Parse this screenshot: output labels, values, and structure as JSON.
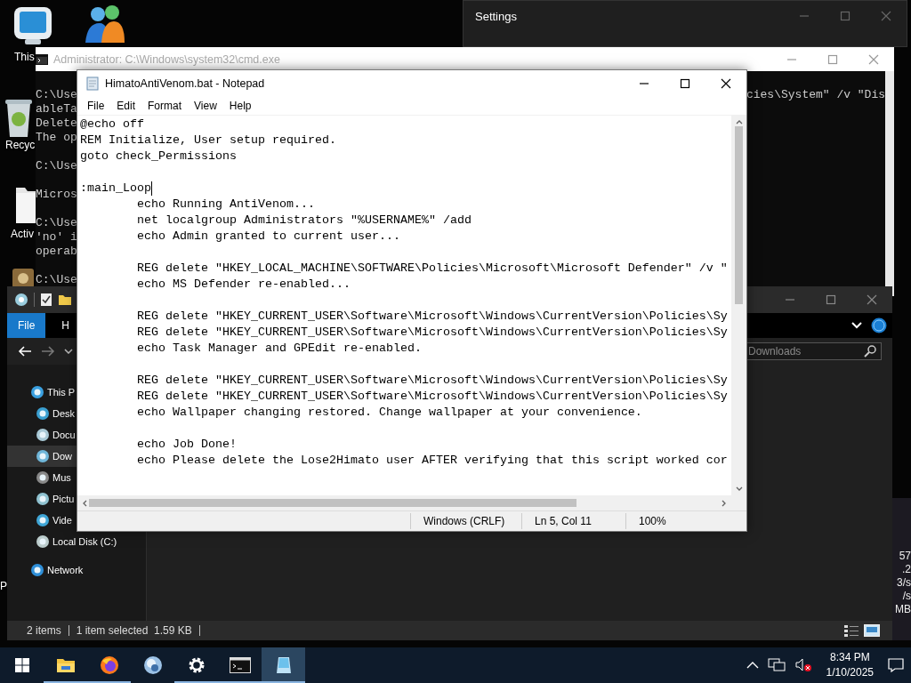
{
  "desktop": {
    "icons": [
      {
        "kind": "monitor",
        "label": "This"
      },
      {
        "kind": "people"
      },
      {
        "kind": "recycle",
        "label": "Recyc"
      },
      {
        "kind": "folder",
        "label": "Activ"
      },
      {
        "kind": "app"
      },
      {
        "kind": "blank",
        "label": "P"
      }
    ]
  },
  "settings_window": {
    "title": "Settings"
  },
  "cmd_window": {
    "title": "Administrator: C:\\Windows\\system32\\cmd.exe",
    "lines": [
      {
        "kind": "text",
        "left": "C:\\Use",
        "right": "cies\\System\" /v \"Dis"
      },
      {
        "kind": "text",
        "left": "ableTa"
      },
      {
        "kind": "text",
        "left": "Delete"
      },
      {
        "kind": "text",
        "left": "The op"
      },
      {
        "kind": "blank"
      },
      {
        "kind": "text",
        "left": "C:\\Use"
      },
      {
        "kind": "blank"
      },
      {
        "kind": "text",
        "left": "Micros"
      },
      {
        "kind": "blank"
      },
      {
        "kind": "text",
        "left": "C:\\Use"
      },
      {
        "kind": "text",
        "left": "'no' i"
      },
      {
        "kind": "text",
        "left": "operab"
      },
      {
        "kind": "blank"
      },
      {
        "kind": "text",
        "left": "C:\\Use"
      }
    ]
  },
  "explorer": {
    "ribbon_tabs": [
      {
        "label": "File",
        "selected": true
      },
      {
        "label": "H",
        "selected": false
      }
    ],
    "search": {
      "placeholder": "Downloads"
    },
    "nav": [
      {
        "label": "This P",
        "kind": "pc",
        "selected": false,
        "children": [
          {
            "label": "Desk",
            "kind": "desktop",
            "selected": false
          },
          {
            "label": "Docu",
            "kind": "documents",
            "selected": false
          },
          {
            "label": "Dow",
            "kind": "downloads",
            "selected": true
          },
          {
            "label": "Mus",
            "kind": "music",
            "selected": false
          },
          {
            "label": "Pictu",
            "kind": "pictures",
            "selected": false
          },
          {
            "label": "Vide",
            "kind": "videos",
            "selected": false
          },
          {
            "label": "Local Disk (C:)",
            "kind": "disk",
            "selected": false
          }
        ]
      },
      {
        "label": "Network",
        "kind": "network",
        "selected": false
      }
    ],
    "status": [
      "2 items",
      "1 item selected  1.59 KB"
    ]
  },
  "notepad": {
    "title": "HimatoAntiVenom.bat - Notepad",
    "menu": [
      "File",
      "Edit",
      "Format",
      "View",
      "Help"
    ],
    "lines": [
      {
        "kind": "code",
        "text": "@echo off",
        "caret": false
      },
      {
        "kind": "code",
        "text": "REM Initialize, User setup required.",
        "caret": false
      },
      {
        "kind": "code",
        "text": "goto check_Permissions",
        "caret": false
      },
      {
        "kind": "blank",
        "caret": false
      },
      {
        "kind": "code",
        "text": ":main_Loop",
        "caret": true
      },
      {
        "kind": "code",
        "text": "\techo Running AntiVenom...",
        "caret": false
      },
      {
        "kind": "code",
        "text": "\tnet localgroup Administrators \"%USERNAME%\" /add",
        "caret": false
      },
      {
        "kind": "code",
        "text": "\techo Admin granted to current user...",
        "caret": false
      },
      {
        "kind": "blank",
        "caret": false
      },
      {
        "kind": "code",
        "text": "\tREG delete \"HKEY_LOCAL_MACHINE\\SOFTWARE\\Policies\\Microsoft\\Microsoft Defender\" /v \"",
        "caret": false
      },
      {
        "kind": "code",
        "text": "\techo MS Defender re-enabled...",
        "caret": false
      },
      {
        "kind": "blank",
        "caret": false
      },
      {
        "kind": "code",
        "text": "\tREG delete \"HKEY_CURRENT_USER\\Software\\Microsoft\\Windows\\CurrentVersion\\Policies\\Sy",
        "caret": false
      },
      {
        "kind": "code",
        "text": "\tREG delete \"HKEY_CURRENT_USER\\Software\\Microsoft\\Windows\\CurrentVersion\\Policies\\Sy",
        "caret": false
      },
      {
        "kind": "code",
        "text": "\techo Task Manager and GPEdit re-enabled.",
        "caret": false
      },
      {
        "kind": "blank",
        "caret": false
      },
      {
        "kind": "code",
        "text": "\tREG delete \"HKEY_CURRENT_USER\\Software\\Microsoft\\Windows\\CurrentVersion\\Policies\\Sy",
        "caret": false
      },
      {
        "kind": "code",
        "text": "\tREG delete \"HKEY_CURRENT_USER\\Software\\Microsoft\\Windows\\CurrentVersion\\Policies\\Sy",
        "caret": false
      },
      {
        "kind": "code",
        "text": "\techo Wallpaper changing restored. Change wallpaper at your convenience.",
        "caret": false
      },
      {
        "kind": "blank",
        "caret": false
      },
      {
        "kind": "code",
        "text": "\techo Job Done!",
        "caret": false
      },
      {
        "kind": "code",
        "text": "\techo Please delete the Lose2Himato user AFTER verifying that this script worked cor",
        "caret": false
      },
      {
        "kind": "blank",
        "caret": false
      }
    ],
    "status": [
      "Windows (CRLF)",
      "Ln 5, Col 11",
      "100%"
    ]
  },
  "side_panel": [
    "57",
    ".2",
    "3/s",
    "/s",
    "MB"
  ],
  "taskbar": {
    "apps": [
      {
        "kind": "start",
        "running": false,
        "active": false
      },
      {
        "kind": "folder",
        "running": true,
        "active": false
      },
      {
        "kind": "browser",
        "running": true,
        "active": false
      },
      {
        "kind": "globe",
        "running": false,
        "active": false
      },
      {
        "kind": "settings",
        "running": true,
        "active": false
      },
      {
        "kind": "terminal",
        "running": true,
        "active": false
      },
      {
        "kind": "notepad",
        "running": true,
        "active": true
      }
    ],
    "clock": {
      "time": "8:34 PM",
      "date": "1/10/2025"
    }
  }
}
